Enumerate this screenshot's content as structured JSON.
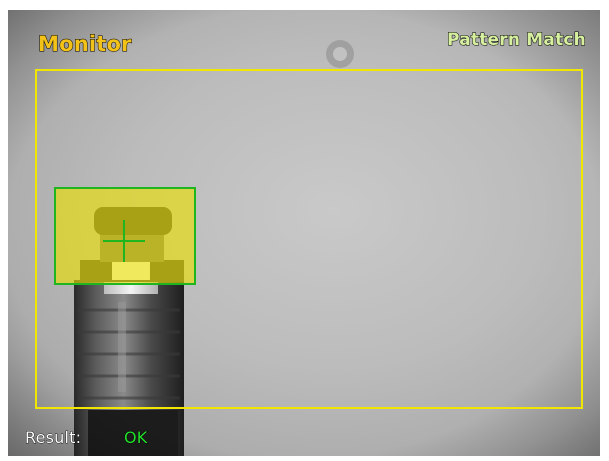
{
  "monitor": {
    "mode_title": "Monitor",
    "tool_name": "Pattern Match",
    "result_label": "Result:",
    "result_value": "OK"
  },
  "colors": {
    "mode_title": "#f2c218",
    "tool_name": "#d6f0a0",
    "search_region": "#f0e600",
    "model_region": "#1fb51f",
    "result_ok": "#22e02a"
  }
}
